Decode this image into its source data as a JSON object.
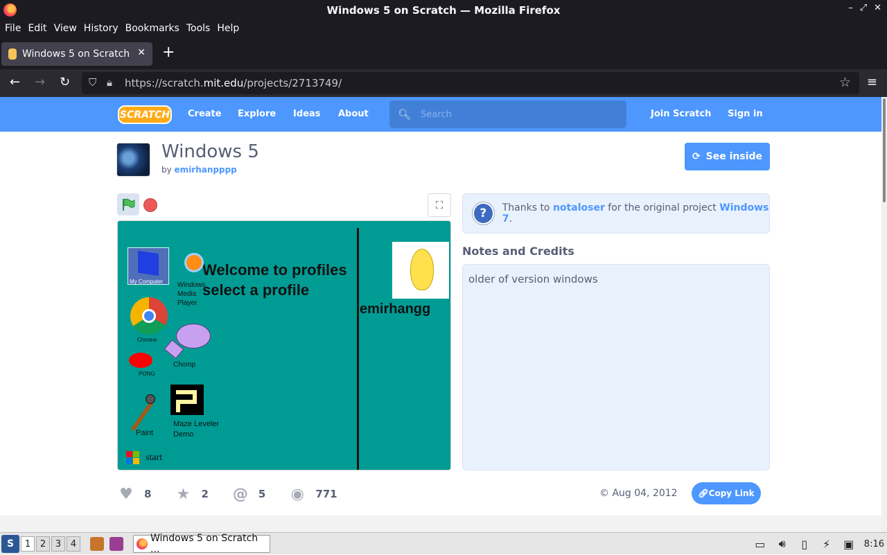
{
  "window": {
    "title": "Windows 5 on Scratch — Mozilla Firefox"
  },
  "menubar": [
    "File",
    "Edit",
    "View",
    "History",
    "Bookmarks",
    "Tools",
    "Help"
  ],
  "tab": {
    "title": "Windows 5 on Scratch"
  },
  "url": {
    "prefix": "https://scratch.",
    "domain": "mit.edu",
    "path": "/projects/2713749/"
  },
  "scratch_nav": {
    "logo": "SCRATCH",
    "links": [
      "Create",
      "Explore",
      "Ideas",
      "About"
    ],
    "search_placeholder": "Search",
    "join": "Join Scratch",
    "signin": "Sign in"
  },
  "project": {
    "title": "Windows 5",
    "by_label": "by",
    "author": "emirhanpppp",
    "see_inside": "See inside"
  },
  "stage": {
    "welcome_line1": "Welcome to profiles",
    "welcome_line2": "select a profile",
    "profile_name": "emirhangg",
    "icons": {
      "my_computer": "My Computer",
      "wmp": "Windows Media Player",
      "chrome": "Chrome",
      "chomp": "Chomp",
      "pong": "PONG",
      "paint": "Paint",
      "maze": "Maze Leveler Demo",
      "start": "start"
    }
  },
  "thanks": {
    "prefix": "Thanks to",
    "user": "notaloser",
    "middle": "for the original project",
    "project": "Windows 7",
    "suffix": "."
  },
  "notes": {
    "heading": "Notes and Credits",
    "text": "older of version windows"
  },
  "stats": {
    "loves": "8",
    "favorites": "2",
    "remixes": "5",
    "views": "771"
  },
  "date": "Aug 04, 2012",
  "copy_link": "Copy Link",
  "taskbar": {
    "workspaces": [
      "1",
      "2",
      "3",
      "4"
    ],
    "window_label": "Windows 5 on Scratch ...",
    "clock": "8:16"
  },
  "colors": {
    "scratch_blue": "#4d97ff",
    "stage_bg": "#009c94",
    "firefox_dark": "#1c1b22"
  }
}
